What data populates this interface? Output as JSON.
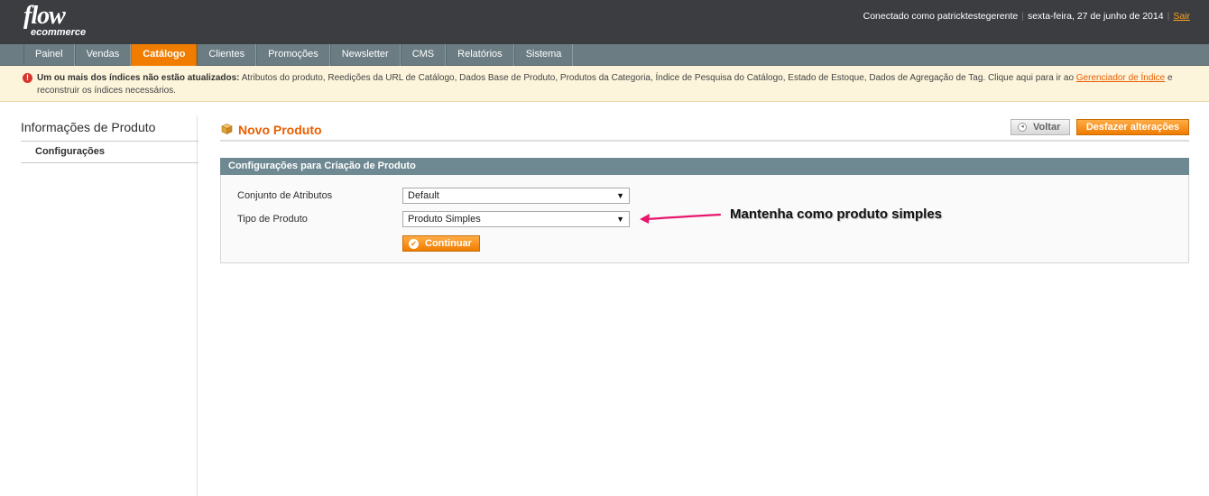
{
  "header": {
    "logo_main": "flow",
    "logo_sub": "ecommerce",
    "connected_as": "Conectado como patricktestegerente",
    "date": "sexta-feira, 27 de junho de 2014",
    "logout": "Sair"
  },
  "nav": {
    "items": [
      "Painel",
      "Vendas",
      "Catálogo",
      "Clientes",
      "Promoções",
      "Newsletter",
      "CMS",
      "Relatórios",
      "Sistema"
    ],
    "active": "Catálogo"
  },
  "notice": {
    "bold": "Um ou mais dos índices não estão atualizados:",
    "text": " Atributos do produto, Reedições da URL de Catálogo, Dados Base de Produto, Produtos da Categoria, Índice de Pesquisa do Catálogo, Estado de Estoque, Dados de Agregação de Tag. Clique aqui para ir ao ",
    "link": "Gerenciador de Índice",
    "tail": " e reconstruir os índices necessários."
  },
  "sidebar": {
    "title": "Informações de Produto",
    "item": "Configurações"
  },
  "page": {
    "title": "Novo Produto",
    "back_label": "Voltar",
    "reset_label": "Desfazer alterações"
  },
  "form": {
    "section_title": "Configurações para Criação de Produto",
    "attribute_set_label": "Conjunto de Atributos",
    "attribute_set_value": "Default",
    "product_type_label": "Tipo de Produto",
    "product_type_value": "Produto Simples",
    "continue_label": "Continuar"
  },
  "annotation": {
    "text": "Mantenha como produto simples",
    "color": "#e8146e"
  }
}
